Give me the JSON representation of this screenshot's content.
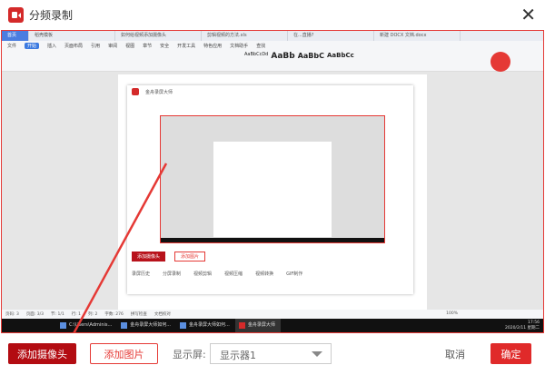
{
  "dialog": {
    "title": "分频录制",
    "close_icon": "close-icon"
  },
  "preview": {
    "tabs": [
      "首页",
      "稻壳模板",
      "如何给视频添加摄像头",
      "剪辑视频的方法.xls",
      "在...直播?",
      "新建 DOCX 文档.docx"
    ],
    "menu": [
      "文件",
      "开始",
      "插入",
      "页面布局",
      "引用",
      "审阅",
      "视图",
      "章节",
      "安全",
      "开发工具",
      "特色应用",
      "文档助手",
      "查找"
    ],
    "styles": [
      "AaBbCcDd",
      "AaBb",
      "AaBbC",
      "AaBbCc"
    ],
    "inner_title": "金舟录屏大师",
    "inner_buttons": [
      "添加摄像头",
      "添加图片"
    ],
    "inner_links": [
      "录屏历史",
      "分屏录制",
      "视频剪辑",
      "视频压缩",
      "视频转换",
      "GIF制作"
    ],
    "status": [
      "页码: 3",
      "页面: 3/3",
      "节: 1/1",
      "行: 1",
      "列: 2",
      "字数: 276",
      "拼写检查",
      "文档校对"
    ],
    "zoom": "100%",
    "taskbar_items": [
      "C:\\Users\\Adminis...",
      "金舟录屏大师如何...",
      "金舟录屏大师如何...",
      "金舟录屏大师"
    ],
    "clock": {
      "time": "17:56",
      "date": "2020/2/11 星期二"
    }
  },
  "footer": {
    "add_camera": "添加摄像头",
    "add_image": "添加图片",
    "display_label": "显示屏:",
    "display_value": "显示器1",
    "cancel": "取消",
    "confirm": "确定"
  },
  "colors": {
    "accent": "#e02a2a",
    "dark_red": "#b30c12"
  }
}
